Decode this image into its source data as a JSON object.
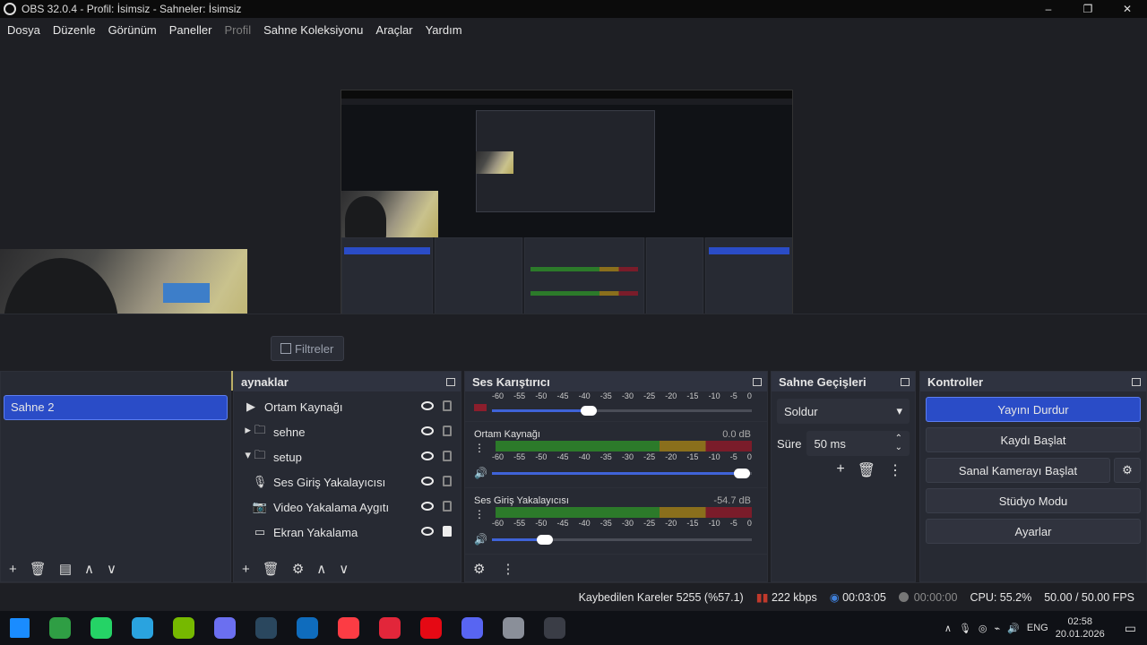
{
  "window": {
    "title": "OBS 32.0.4 - Profil: İsimsiz - Sahneler: İsimsiz",
    "controls": [
      "–",
      "❐",
      "✕"
    ]
  },
  "menu": [
    {
      "label": "Dosya"
    },
    {
      "label": "Düzenle"
    },
    {
      "label": "Görünüm"
    },
    {
      "label": "Paneller"
    },
    {
      "label": "Profil",
      "disabled": true
    },
    {
      "label": "Sahne Koleksiyonu"
    },
    {
      "label": "Araçlar"
    },
    {
      "label": "Yardım"
    }
  ],
  "filters_button": "Filtreler",
  "scenes": {
    "items": [
      "Sahne 2"
    ],
    "toolbar": [
      "+",
      "🗑",
      "▤",
      "∧",
      "∨"
    ]
  },
  "sources": {
    "title": "aynaklar",
    "items": [
      {
        "label": "Ortam Kaynağı",
        "icon": "play-icon",
        "glyph": "▶",
        "indent": 0,
        "locked": false
      },
      {
        "label": "sehne",
        "icon": "folder-icon",
        "glyph": "▸ 🗀",
        "indent": 0,
        "locked": false
      },
      {
        "label": "setup",
        "icon": "folder-icon",
        "glyph": "▾ 🗀",
        "indent": 0,
        "locked": false
      },
      {
        "label": "Ses Giriş Yakalayıcısı",
        "icon": "microphone-icon",
        "glyph": "🎙",
        "indent": 1,
        "locked": false
      },
      {
        "label": "Video Yakalama Aygıtı",
        "icon": "camera-icon",
        "glyph": "📷",
        "indent": 1,
        "locked": false
      },
      {
        "label": "Ekran Yakalama",
        "icon": "monitor-icon",
        "glyph": "▭",
        "indent": 1,
        "locked": true
      }
    ]
  },
  "mixer": {
    "title": "Ses Karıştırıcı",
    "scale": [
      "-60",
      "-55",
      "-50",
      "-45",
      "-40",
      "-35",
      "-30",
      "-25",
      "-20",
      "-15",
      "-10",
      "-5",
      "0"
    ],
    "tracks": [
      {
        "name": "Ortam Kaynağı",
        "db": "0.0 dB",
        "level": 0.98
      },
      {
        "name": "Ses Giriş Yakalayıcısı",
        "db": "-54.7 dB",
        "level": 0.22
      }
    ]
  },
  "transitions": {
    "title": "Sahne Geçişleri",
    "selected": "Soldur",
    "duration_label": "Süre",
    "duration_value": "50 ms"
  },
  "controls": {
    "title": "Kontroller",
    "buttons": [
      "Yayını Durdur",
      "Kaydı Başlat",
      "Sanal Kamerayı Başlat",
      "Stüdyo Modu",
      "Ayarlar"
    ]
  },
  "status": {
    "dropped": "Kaybedilen Kareler 5255 (%57.1)",
    "bitrate": "222 kbps",
    "stream_time": "00:03:05",
    "rec_time": "00:00:00",
    "cpu": "CPU: 55.2%",
    "fps": "50.00 / 50.00 FPS"
  },
  "taskbar": {
    "icons": [
      {
        "name": "windows-start-icon",
        "color": "#1a8cff"
      },
      {
        "name": "chrome-icon",
        "color": "#2f9e44"
      },
      {
        "name": "whatsapp-icon",
        "color": "#25d366"
      },
      {
        "name": "telegram-icon",
        "color": "#2aa3df"
      },
      {
        "name": "nvidia-icon",
        "color": "#76b900"
      },
      {
        "name": "settings-app-icon",
        "color": "#6b6ff0"
      },
      {
        "name": "steam-icon",
        "color": "#2a475e"
      },
      {
        "name": "outlook-icon",
        "color": "#0f6cbd"
      },
      {
        "name": "music-icon",
        "color": "#fc3c44"
      },
      {
        "name": "player-icon",
        "color": "#e2263a"
      },
      {
        "name": "netflix-icon",
        "color": "#e50914"
      },
      {
        "name": "discord-icon",
        "color": "#5865f2"
      },
      {
        "name": "speedometer-icon",
        "color": "#8a8f99"
      },
      {
        "name": "obs-icon",
        "color": "#3a3d46"
      }
    ],
    "lang": "ENG",
    "time": "02:58",
    "date": "20.01.2026"
  }
}
